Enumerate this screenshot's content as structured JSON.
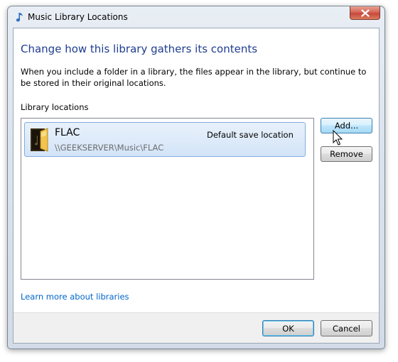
{
  "window": {
    "title": "Music Library Locations",
    "title_icon": "music-note-icon",
    "close_icon": "close-icon"
  },
  "dialog": {
    "heading": "Change how this library gathers its contents",
    "description": "When you include a folder in a library, the files appear in the library, but continue to be stored in their original locations.",
    "section_label": "Library locations"
  },
  "locations": [
    {
      "name": "FLAC",
      "path": "\\\\GEEKSERVER\\Music\\FLAC",
      "badge": "Default save location",
      "icon": "folder-icon",
      "selected": true
    }
  ],
  "buttons": {
    "add": "Add...",
    "remove": "Remove",
    "ok": "OK",
    "cancel": "Cancel"
  },
  "link": {
    "learn_more": "Learn more about libraries"
  },
  "colors": {
    "heading": "#1e3d91",
    "link": "#0066cc",
    "selection": "#d3e4f8"
  }
}
